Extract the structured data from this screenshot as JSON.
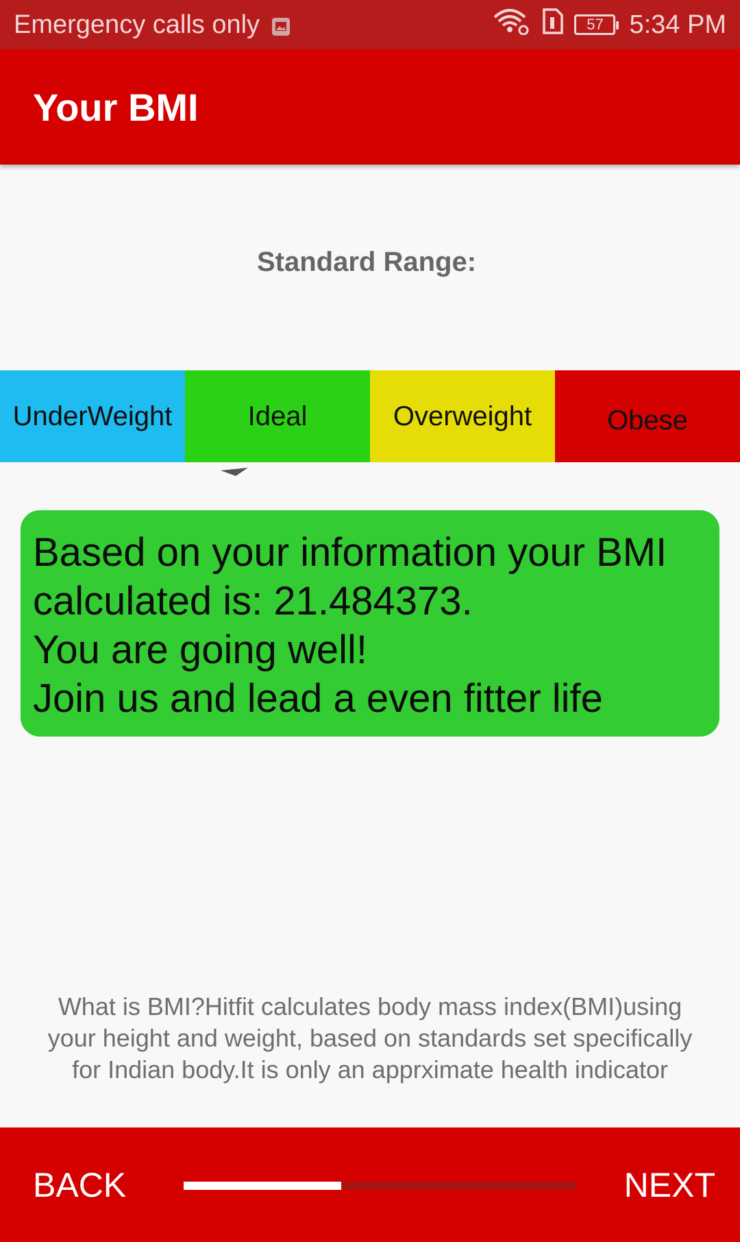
{
  "status_bar": {
    "carrier_text": "Emergency calls only",
    "battery_level": "57",
    "time": "5:34 PM",
    "icons": [
      "image-notification-icon",
      "wifi-icon",
      "sim-card-icon",
      "battery-icon"
    ]
  },
  "app_bar": {
    "title": "Your BMI"
  },
  "range": {
    "heading": "Standard Range:",
    "segments": [
      {
        "label": "UnderWeight",
        "color": "#1ebcf0"
      },
      {
        "label": "Ideal",
        "color": "#2bd114"
      },
      {
        "label": "Overweight",
        "color": "#e6dc06"
      },
      {
        "label": "Obese",
        "color": "#d50000"
      }
    ]
  },
  "result": {
    "line1": "Based on your information your BMI",
    "line2": "calculated is: 21.484373.",
    "line3": "You are going well!",
    "line4": "Join us and lead a even fitter life",
    "bg_color": "#33cc33"
  },
  "info": {
    "text": "What is BMI?Hitfit calculates body mass index(BMI)using your height and weight, based on standards set specifically for Indian body.It is only an apprximate health indicator"
  },
  "bottom_bar": {
    "back_label": "BACK",
    "next_label": "NEXT",
    "progress_percent": 40
  },
  "colors": {
    "primary": "#d50000",
    "status_bar": "#b71c1c"
  }
}
